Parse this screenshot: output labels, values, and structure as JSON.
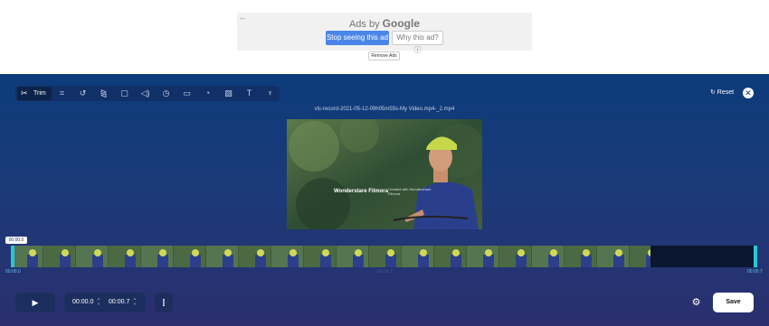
{
  "ad": {
    "back_arrow": "←",
    "ads_by": "Ads by",
    "google": "Google",
    "stop_label": "Stop seeing this ad",
    "why_label": "Why this ad? ⓘ",
    "remove_label": "Remove Ads"
  },
  "toolbar": {
    "trim_label": "Trim",
    "tools": [
      {
        "name": "crop-icon",
        "glyph": "⌗"
      },
      {
        "name": "rotate-icon",
        "glyph": "↺"
      },
      {
        "name": "flip-icon",
        "glyph": "⧎"
      },
      {
        "name": "resize-icon",
        "glyph": "▢"
      },
      {
        "name": "volume-icon",
        "glyph": "◁)"
      },
      {
        "name": "speed-icon",
        "glyph": "◷"
      },
      {
        "name": "loop-icon",
        "glyph": "▭"
      },
      {
        "name": "filter-icon",
        "glyph": "◔"
      },
      {
        "name": "image-icon",
        "glyph": "▨"
      },
      {
        "name": "text-icon",
        "glyph": "T"
      },
      {
        "name": "watermark-icon",
        "glyph": "♆"
      }
    ],
    "reset_label": "↻ Reset",
    "close_glyph": "✕"
  },
  "video": {
    "filename": "vlc-record-2021-05-12-09h05m55s-My Video.mp4-_2.mp4",
    "watermark_brand": "Wonderstare Filmora",
    "watermark_note": "Created with Wondershare Filmora"
  },
  "timeline": {
    "current_badge": "00:00.0",
    "start_label": "00:00.0",
    "end_label": "00:00.7",
    "mid_label": "00:00.7"
  },
  "controls": {
    "play_glyph": "▶",
    "start_time": "00:00.0",
    "end_time": "00:00.7",
    "split_glyph": "⫿",
    "settings_glyph": "⚙",
    "save_label": "Save"
  },
  "colors": {
    "accent_handle": "#26c6da",
    "ad_blue": "#4a86e8",
    "editor_top": "#0d3b7a",
    "editor_bottom": "#2b2f6e"
  }
}
